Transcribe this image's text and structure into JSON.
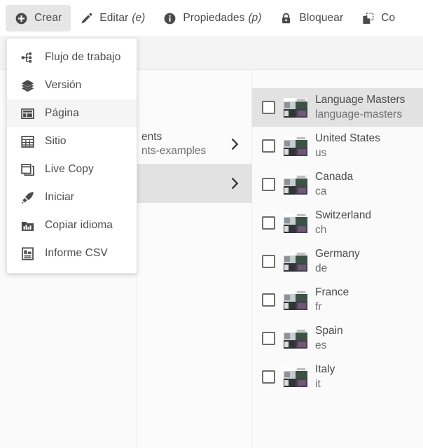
{
  "toolbar": {
    "items": [
      {
        "label": "Crear",
        "shortcut": "",
        "icon": "plus-circle-icon",
        "active": true
      },
      {
        "label": "Editar",
        "shortcut": "(e)",
        "icon": "pencil-icon",
        "active": false
      },
      {
        "label": "Propiedades",
        "shortcut": "(p)",
        "icon": "info-circle-icon",
        "active": false
      },
      {
        "label": "Bloquear",
        "shortcut": "",
        "icon": "lock-icon",
        "active": false
      },
      {
        "label": "Co",
        "shortcut": "",
        "icon": "copy-icon",
        "active": false
      }
    ]
  },
  "create_menu": {
    "items": [
      {
        "label": "Flujo de trabajo",
        "icon": "workflow-icon",
        "hover": false
      },
      {
        "label": "Versión",
        "icon": "layers-icon",
        "hover": false
      },
      {
        "label": "Página",
        "icon": "page-icon",
        "hover": true
      },
      {
        "label": "Sitio",
        "icon": "site-grid-icon",
        "hover": false
      },
      {
        "label": "Live Copy",
        "icon": "live-copy-icon",
        "hover": false
      },
      {
        "label": "Iniciar",
        "icon": "rocket-icon",
        "hover": false
      },
      {
        "label": "Copiar idioma",
        "icon": "language-copy-icon",
        "hover": false
      },
      {
        "label": "Informe CSV",
        "icon": "csv-report-icon",
        "hover": false
      }
    ]
  },
  "middle_column": {
    "rows": [
      {
        "title": "ents",
        "subtitle": "nts-examples",
        "selected": false
      },
      {
        "title": "",
        "subtitle": "",
        "selected": true
      }
    ]
  },
  "right_column": {
    "rows": [
      {
        "title": "Language Masters",
        "subtitle": "language-masters",
        "selected": true,
        "checked": false
      },
      {
        "title": "United States",
        "subtitle": "us",
        "selected": false,
        "checked": false
      },
      {
        "title": "Canada",
        "subtitle": "ca",
        "selected": false,
        "checked": false
      },
      {
        "title": "Switzerland",
        "subtitle": "ch",
        "selected": false,
        "checked": false
      },
      {
        "title": "Germany",
        "subtitle": "de",
        "selected": false,
        "checked": false
      },
      {
        "title": "France",
        "subtitle": "fr",
        "selected": false,
        "checked": false
      },
      {
        "title": "Spain",
        "subtitle": "es",
        "selected": false,
        "checked": false
      },
      {
        "title": "Italy",
        "subtitle": "it",
        "selected": false,
        "checked": false
      }
    ]
  },
  "colors": {
    "text": "#4b4b4b",
    "subtext": "#6f6f6f",
    "selected_row": "#e2e2e2",
    "hover_row": "#f5f5f5",
    "panel_bg": "#fafafa",
    "header_band": "#f4f4f4"
  }
}
